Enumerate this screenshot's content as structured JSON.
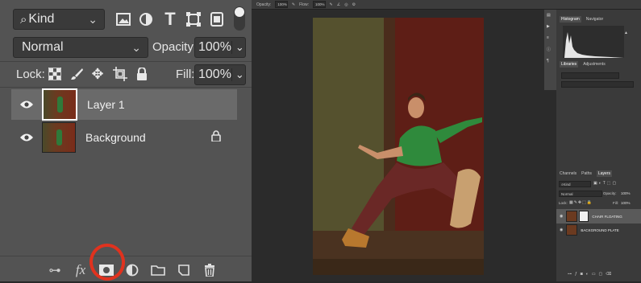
{
  "left_panel": {
    "filter_kind": "Kind",
    "blend_mode": "Normal",
    "opacity_label": "Opacity:",
    "opacity_value": "100%",
    "lock_label": "Lock:",
    "fill_label": "Fill:",
    "fill_value": "100%",
    "layers": [
      {
        "name": "Layer 1",
        "selected": true
      },
      {
        "name": "Background",
        "locked": true
      }
    ],
    "bottom_icons": [
      "link-icon",
      "fx-icon",
      "layer-mask-icon",
      "adjustment-icon",
      "folder-icon",
      "new-layer-icon",
      "trash-icon"
    ]
  },
  "top_bar": {
    "opacity_label": "Opacity:",
    "opacity_value": "100%",
    "flow_label": "Flow:",
    "flow_value": "100%"
  },
  "right_panel": {
    "tabs_top": [
      "Histogram",
      "Navigator"
    ],
    "tabs_lib": [
      "Libraries",
      "Adjustments"
    ],
    "tabs_layers": [
      "Channels",
      "Paths",
      "Layers"
    ],
    "filter_kind": "Kind",
    "blend_mode": "Normal",
    "opacity_label": "Opacity:",
    "opacity_value": "100%",
    "lock_label": "Lock:",
    "fill_label": "Fill:",
    "fill_value": "100%",
    "layers": [
      {
        "name": "CHAIR FLOATING",
        "selected": true
      },
      {
        "name": "BACKGROUND PLATE"
      }
    ]
  },
  "colors": {
    "highlight_circle": "#e0321e",
    "panel_bg": "#535353",
    "selected_row": "#6a6a6a"
  }
}
